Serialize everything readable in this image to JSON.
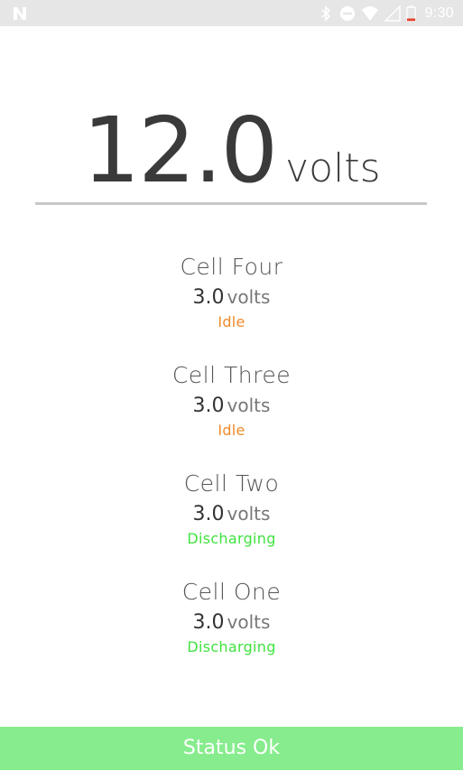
{
  "status_bar": {
    "time": "9:30",
    "icons": [
      "notification-n-icon",
      "bluetooth-icon",
      "do-not-disturb-icon",
      "wifi-icon",
      "cellular-icon",
      "battery-low-icon"
    ]
  },
  "total": {
    "value": "12.0",
    "unit": "volts"
  },
  "cells": [
    {
      "name": "Cell Four",
      "value": "3.0",
      "unit": "volts",
      "status": "Idle"
    },
    {
      "name": "Cell Three",
      "value": "3.0",
      "unit": "volts",
      "status": "Idle"
    },
    {
      "name": "Cell Two",
      "value": "3.0",
      "unit": "volts",
      "status": "Discharging"
    },
    {
      "name": "Cell One",
      "value": "3.0",
      "unit": "volts",
      "status": "Discharging"
    }
  ],
  "footer": {
    "status_text": "Status Ok"
  },
  "colors": {
    "idle": "#ef8a2a",
    "discharging": "#3fe33f",
    "status_ok_bar": "#86ec8d"
  }
}
